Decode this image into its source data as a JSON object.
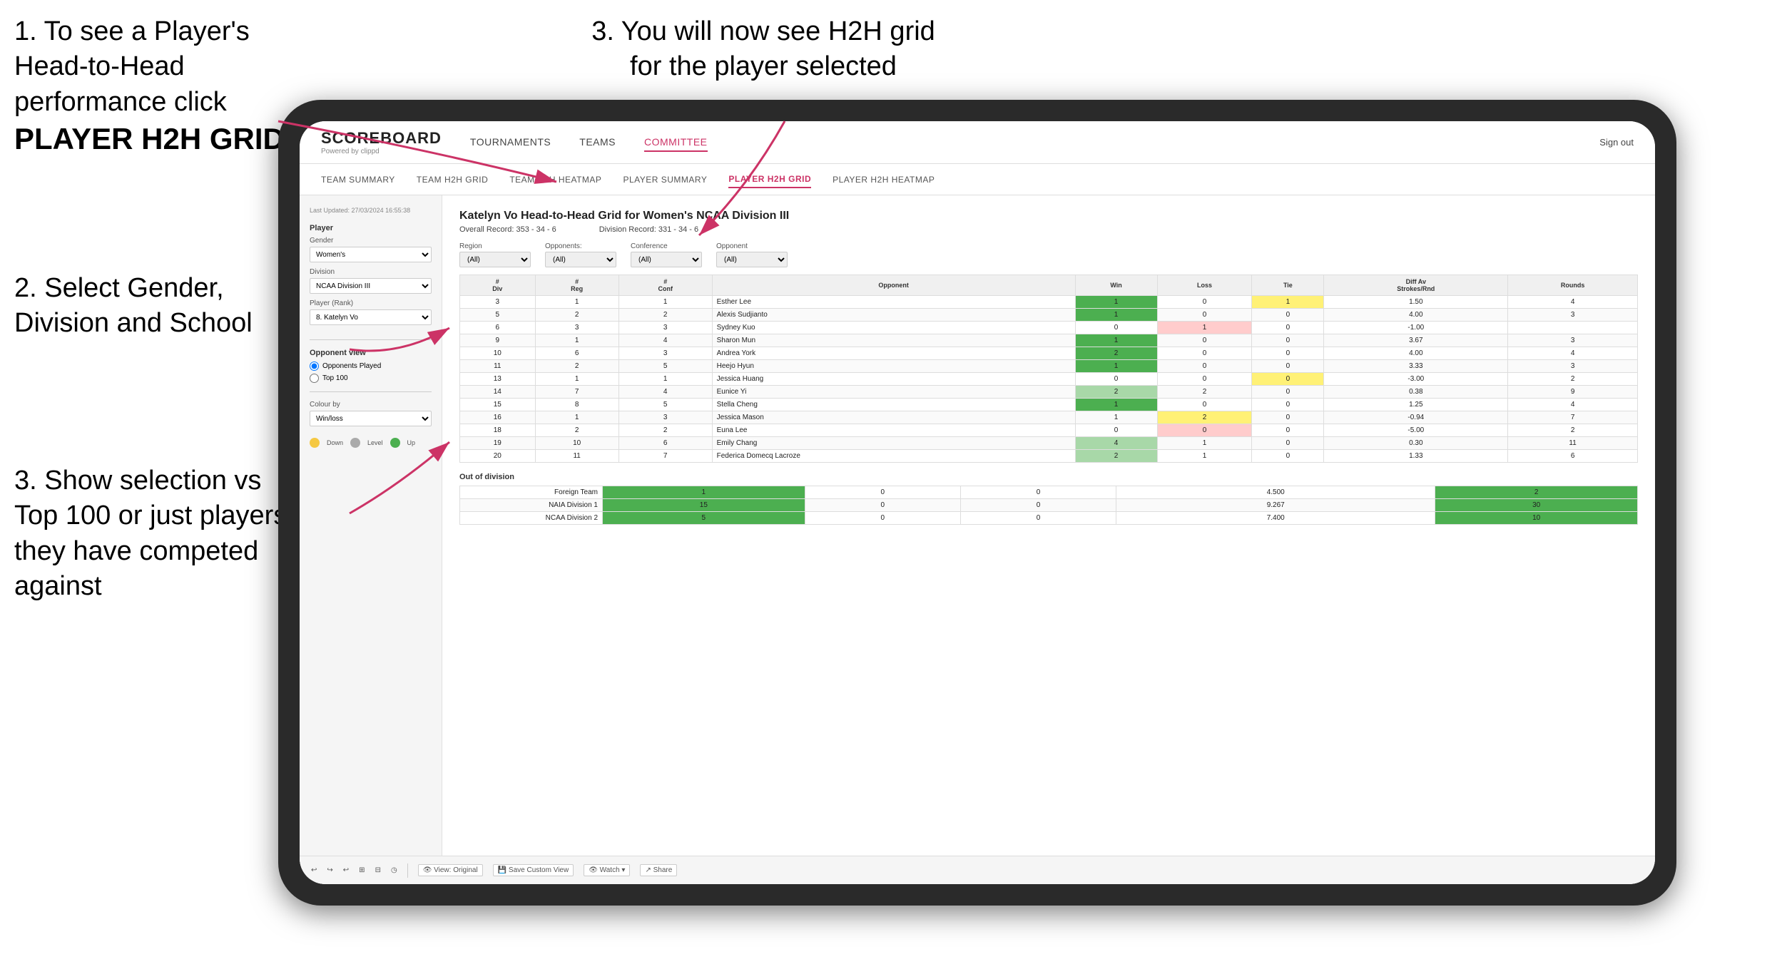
{
  "instructions": {
    "top_left_1": "1. To see a Player's Head-to-Head performance click",
    "top_left_bold": "PLAYER H2H GRID",
    "top_right": "3. You will now see H2H grid for the player selected",
    "mid_left": "2. Select Gender, Division and School",
    "bottom_left": "3. Show selection vs Top 100 or just players they have competed against"
  },
  "nav": {
    "logo": "SCOREBOARD",
    "logo_sub": "Powered by clippd",
    "items": [
      "TOURNAMENTS",
      "TEAMS",
      "COMMITTEE"
    ],
    "active_item": "COMMITTEE",
    "sign_out": "Sign out"
  },
  "sub_nav": {
    "items": [
      "TEAM SUMMARY",
      "TEAM H2H GRID",
      "TEAM H2H HEATMAP",
      "PLAYER SUMMARY",
      "PLAYER H2H GRID",
      "PLAYER H2H HEATMAP"
    ],
    "active": "PLAYER H2H GRID"
  },
  "sidebar": {
    "timestamp": "Last Updated: 27/03/2024 16:55:38",
    "player_section": "Player",
    "gender_label": "Gender",
    "gender_value": "Women's",
    "division_label": "Division",
    "division_value": "NCAA Division III",
    "player_rank_label": "Player (Rank)",
    "player_rank_value": "8. Katelyn Vo",
    "opponent_view_label": "Opponent view",
    "radio_options": [
      "Opponents Played",
      "Top 100"
    ],
    "radio_selected": "Opponents Played",
    "colour_by_label": "Colour by",
    "colour_by_value": "Win/loss",
    "legend": [
      {
        "color": "#f5c842",
        "label": "Down"
      },
      {
        "color": "#aaaaaa",
        "label": "Level"
      },
      {
        "color": "#4caf50",
        "label": "Up"
      }
    ]
  },
  "content": {
    "title": "Katelyn Vo Head-to-Head Grid for Women's NCAA Division III",
    "overall_record": "Overall Record: 353 - 34 - 6",
    "division_record": "Division Record: 331 - 34 - 6",
    "filters": {
      "region_label": "Region",
      "region_value": "(All)",
      "opponents_label": "Opponents:",
      "opponents_value": "(All)",
      "conference_label": "Conference",
      "conference_value": "(All)",
      "opponent_label": "Opponent",
      "opponent_value": "(All)"
    },
    "table_headers": [
      "#Div",
      "#Reg",
      "#Conf",
      "Opponent",
      "Win",
      "Loss",
      "Tie",
      "Diff Av Strokes/Rnd",
      "Rounds"
    ],
    "rows": [
      {
        "div": "3",
        "reg": "1",
        "conf": "1",
        "opponent": "Esther Lee",
        "win": "1",
        "loss": "0",
        "tie": "1",
        "diff": "1.50",
        "rounds": "4",
        "win_class": "cell-green",
        "loss_class": "",
        "tie_class": "cell-yellow"
      },
      {
        "div": "5",
        "reg": "2",
        "conf": "2",
        "opponent": "Alexis Sudjianto",
        "win": "1",
        "loss": "0",
        "tie": "0",
        "diff": "4.00",
        "rounds": "3",
        "win_class": "cell-green",
        "loss_class": "",
        "tie_class": ""
      },
      {
        "div": "6",
        "reg": "3",
        "conf": "3",
        "opponent": "Sydney Kuo",
        "win": "0",
        "loss": "1",
        "tie": "0",
        "diff": "-1.00",
        "rounds": "",
        "win_class": "",
        "loss_class": "cell-red",
        "tie_class": ""
      },
      {
        "div": "9",
        "reg": "1",
        "conf": "4",
        "opponent": "Sharon Mun",
        "win": "1",
        "loss": "0",
        "tie": "0",
        "diff": "3.67",
        "rounds": "3",
        "win_class": "cell-green",
        "loss_class": "",
        "tie_class": ""
      },
      {
        "div": "10",
        "reg": "6",
        "conf": "3",
        "opponent": "Andrea York",
        "win": "2",
        "loss": "0",
        "tie": "0",
        "diff": "4.00",
        "rounds": "4",
        "win_class": "cell-green",
        "loss_class": "",
        "tie_class": ""
      },
      {
        "div": "11",
        "reg": "2",
        "conf": "5",
        "opponent": "Heejo Hyun",
        "win": "1",
        "loss": "0",
        "tie": "0",
        "diff": "3.33",
        "rounds": "3",
        "win_class": "cell-green",
        "loss_class": "",
        "tie_class": ""
      },
      {
        "div": "13",
        "reg": "1",
        "conf": "1",
        "opponent": "Jessica Huang",
        "win": "0",
        "loss": "0",
        "tie": "0",
        "diff": "-3.00",
        "rounds": "2",
        "win_class": "",
        "loss_class": "",
        "tie_class": "cell-yellow"
      },
      {
        "div": "14",
        "reg": "7",
        "conf": "4",
        "opponent": "Eunice Yi",
        "win": "2",
        "loss": "2",
        "tie": "0",
        "diff": "0.38",
        "rounds": "9",
        "win_class": "cell-light-green",
        "loss_class": "",
        "tie_class": ""
      },
      {
        "div": "15",
        "reg": "8",
        "conf": "5",
        "opponent": "Stella Cheng",
        "win": "1",
        "loss": "0",
        "tie": "0",
        "diff": "1.25",
        "rounds": "4",
        "win_class": "cell-green",
        "loss_class": "",
        "tie_class": ""
      },
      {
        "div": "16",
        "reg": "1",
        "conf": "3",
        "opponent": "Jessica Mason",
        "win": "1",
        "loss": "2",
        "tie": "0",
        "diff": "-0.94",
        "rounds": "7",
        "win_class": "",
        "loss_class": "cell-yellow",
        "tie_class": ""
      },
      {
        "div": "18",
        "reg": "2",
        "conf": "2",
        "opponent": "Euna Lee",
        "win": "0",
        "loss": "0",
        "tie": "0",
        "diff": "-5.00",
        "rounds": "2",
        "win_class": "",
        "loss_class": "cell-red",
        "tie_class": ""
      },
      {
        "div": "19",
        "reg": "10",
        "conf": "6",
        "opponent": "Emily Chang",
        "win": "4",
        "loss": "1",
        "tie": "0",
        "diff": "0.30",
        "rounds": "11",
        "win_class": "cell-light-green",
        "loss_class": "",
        "tie_class": ""
      },
      {
        "div": "20",
        "reg": "11",
        "conf": "7",
        "opponent": "Federica Domecq Lacroze",
        "win": "2",
        "loss": "1",
        "tie": "0",
        "diff": "1.33",
        "rounds": "6",
        "win_class": "cell-light-green",
        "loss_class": "",
        "tie_class": ""
      }
    ],
    "out_of_division_header": "Out of division",
    "out_of_division_rows": [
      {
        "label": "Foreign Team",
        "win": "1",
        "loss": "0",
        "tie": "0",
        "diff": "4.500",
        "rounds": "2"
      },
      {
        "label": "NAIA Division 1",
        "win": "15",
        "loss": "0",
        "tie": "0",
        "diff": "9.267",
        "rounds": "30"
      },
      {
        "label": "NCAA Division 2",
        "win": "5",
        "loss": "0",
        "tie": "0",
        "diff": "7.400",
        "rounds": "10"
      }
    ]
  },
  "toolbar": {
    "buttons": [
      "View: Original",
      "Save Custom View",
      "Watch ▾",
      "Share"
    ]
  }
}
